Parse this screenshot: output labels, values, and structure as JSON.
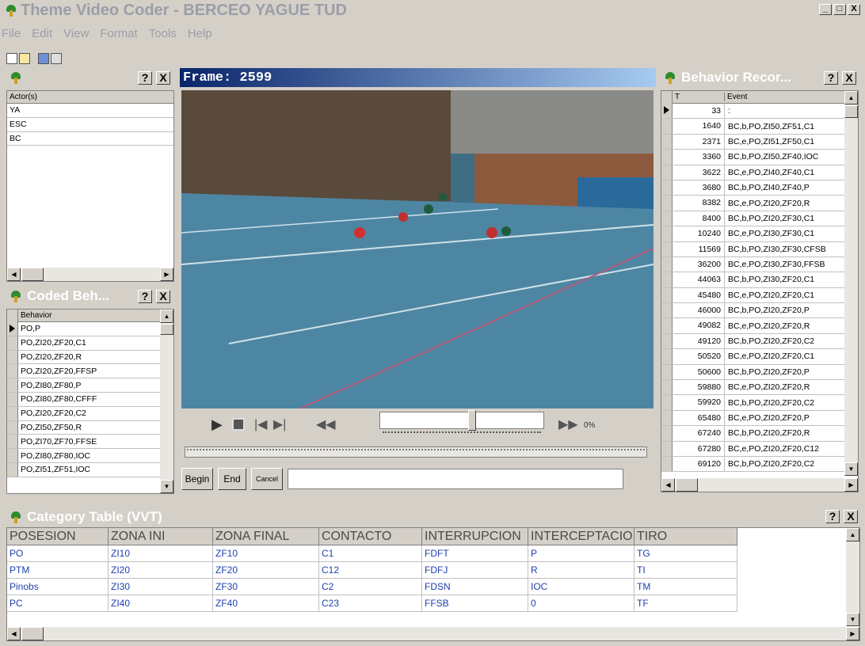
{
  "window": {
    "title": "Theme Video Coder - BERCEO YAGUE TUD",
    "minimize": "_",
    "maximize": "□",
    "close": "X"
  },
  "menu": [
    "File",
    "Edit",
    "View",
    "Format",
    "Tools",
    "Help"
  ],
  "actors_panel": {
    "header": "Actor(s)",
    "help": "?",
    "close": "X",
    "items": [
      "YA",
      "ESC",
      "BC"
    ]
  },
  "coded_panel": {
    "title": "Coded Beh...",
    "help": "?",
    "close": "X",
    "header": "Behavior",
    "items": [
      "PO,P",
      "PO,ZI20,ZF20,C1",
      "PO,ZI20,ZF20,R",
      "PO,ZI20,ZF20,FFSP",
      "PO,ZI80,ZF80,P",
      "PO,ZI80,ZF80,CFFF",
      "PO,ZI20,ZF20,C2",
      "PO,ZI50,ZF50,R",
      "PO,ZI70,ZF70,FFSE",
      "PO,ZI80,ZF80,IOC",
      "PO,ZI51,ZF51,IOC"
    ]
  },
  "video": {
    "frame_label": "Frame: 2599",
    "progress_percent": "0%",
    "slider_fraction": 0.56,
    "begin": "Begin",
    "end": "End",
    "cancel": "Cancel",
    "comment_value": ""
  },
  "behavior_panel": {
    "title": "Behavior Recor...",
    "help": "?",
    "close": "X",
    "col_t": "T",
    "col_event": "Event",
    "rows": [
      {
        "t": "33",
        "e": ":"
      },
      {
        "t": "1640",
        "e": "BC,b,PO,ZI50,ZF51,C1"
      },
      {
        "t": "2371",
        "e": "BC,e,PO,ZI51,ZF50,C1"
      },
      {
        "t": "3360",
        "e": "BC,b,PO,ZI50,ZF40,IOC"
      },
      {
        "t": "3622",
        "e": "BC,e,PO,ZI40,ZF40,C1"
      },
      {
        "t": "3680",
        "e": "BC,b,PO,ZI40,ZF40,P"
      },
      {
        "t": "8382",
        "e": "BC,e,PO,ZI20,ZF20,R"
      },
      {
        "t": "8400",
        "e": "BC,b,PO,ZI20,ZF30,C1"
      },
      {
        "t": "10240",
        "e": "BC,e,PO,ZI30,ZF30,C1"
      },
      {
        "t": "11569",
        "e": "BC,b,PO,ZI30,ZF30,CFSB"
      },
      {
        "t": "36200",
        "e": "BC,e,PO,ZI30,ZF30,FFSB"
      },
      {
        "t": "44063",
        "e": "BC,b,PO,ZI30,ZF20,C1"
      },
      {
        "t": "45480",
        "e": "BC,e,PO,ZI20,ZF20,C1"
      },
      {
        "t": "46000",
        "e": "BC,b,PO,ZI20,ZF20,P"
      },
      {
        "t": "49082",
        "e": "BC,e,PO,ZI20,ZF20,R"
      },
      {
        "t": "49120",
        "e": "BC,b,PO,ZI20,ZF20,C2"
      },
      {
        "t": "50520",
        "e": "BC,e,PO,ZI20,ZF20,C1"
      },
      {
        "t": "50600",
        "e": "BC,b,PO,ZI20,ZF20,P"
      },
      {
        "t": "59880",
        "e": "BC,e,PO,ZI20,ZF20,R"
      },
      {
        "t": "59920",
        "e": "BC,b,PO,ZI20,ZF20,C2"
      },
      {
        "t": "65480",
        "e": "BC,e,PO,ZI20,ZF20,P"
      },
      {
        "t": "67240",
        "e": "BC,b,PO,ZI20,ZF20,R"
      },
      {
        "t": "67280",
        "e": "BC,e,PO,ZI20,ZF20,C12"
      },
      {
        "t": "69120",
        "e": "BC,b,PO,ZI20,ZF20,C2"
      }
    ]
  },
  "category_table": {
    "title": "Category Table (VVT)",
    "help": "?",
    "close": "X",
    "headers": [
      "POSESION",
      "ZONA INI",
      "ZONA FINAL",
      "CONTACTO",
      "INTERRUPCION",
      "INTERCEPTACIO",
      "TIRO"
    ],
    "rows": [
      [
        "PO",
        "ZI10",
        "ZF10",
        "C1",
        "FDFT",
        "P",
        "TG"
      ],
      [
        "PTM",
        "ZI20",
        "ZF20",
        "C12",
        "FDFJ",
        "R",
        "TI"
      ],
      [
        "Pinobs",
        "ZI30",
        "ZF30",
        "C2",
        "FDSN",
        "IOC",
        "TM"
      ],
      [
        "PC",
        "ZI40",
        "ZF40",
        "C23",
        "FFSB",
        "0",
        "TF"
      ]
    ]
  }
}
